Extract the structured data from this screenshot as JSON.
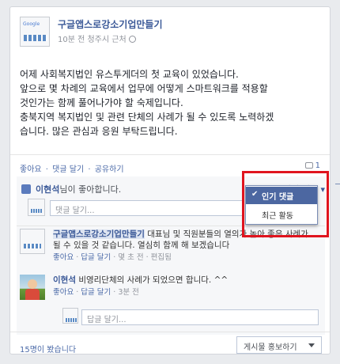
{
  "post": {
    "page_name": "구글앱스로강소기업만들기",
    "meta": "10분 전 청주시 근처",
    "logo_text": "Google",
    "lines": [
      "어제 사회복지법인 유스투게더의 첫 교육이 있었습니다.",
      "앞으로 몇 차례의 교육에서 업무에 어떻게 스마트워크를 적용할",
      "것인가는 함께 풀어나가야 할 숙제입니다.",
      "충북지역 복지법인 및 관련 단체의 사례가 될 수 있도록 노력하겠",
      "습니다. 많은 관심과 응원 부탁드립니다."
    ]
  },
  "actions": {
    "like": "좋아요",
    "comment": "댓글 달기",
    "share": "공유하기",
    "sep": "·",
    "comment_count": "1"
  },
  "likes": {
    "name": "이현석",
    "suffix": "님이 좋아합니다."
  },
  "sort": {
    "label": "인기 댓글 ▾",
    "options": [
      "인기 댓글",
      "최근 활동"
    ],
    "selected": "인기 댓글"
  },
  "comment_input": {
    "placeholder": "댓글 달기..."
  },
  "comments": [
    {
      "author": "구글앱스로강소기업만들기",
      "text": " 대표님 및 직원분들의 열의가 높아 좋은 사례가 될 수 있을 것 같습니다. 열심히 함께 해 보겠습니다",
      "like": "좋아요",
      "reply": "답글 달기",
      "time": "몇 초 전",
      "edit": "편집됨"
    },
    {
      "author": "이현석",
      "text": " 비영리단체의 사례가 되었으면 합니다. ^^",
      "like": "좋아요",
      "reply": "답글 달기",
      "time": "3분 전"
    }
  ],
  "reply_input": {
    "placeholder": "답글 달기..."
  },
  "footer": {
    "seen": "15명이 봤습니다",
    "promote": "게시물 홍보하기"
  },
  "colors": {
    "link": "#3b5998",
    "highlight": "#e0141e",
    "selected": "#4c67a1"
  }
}
